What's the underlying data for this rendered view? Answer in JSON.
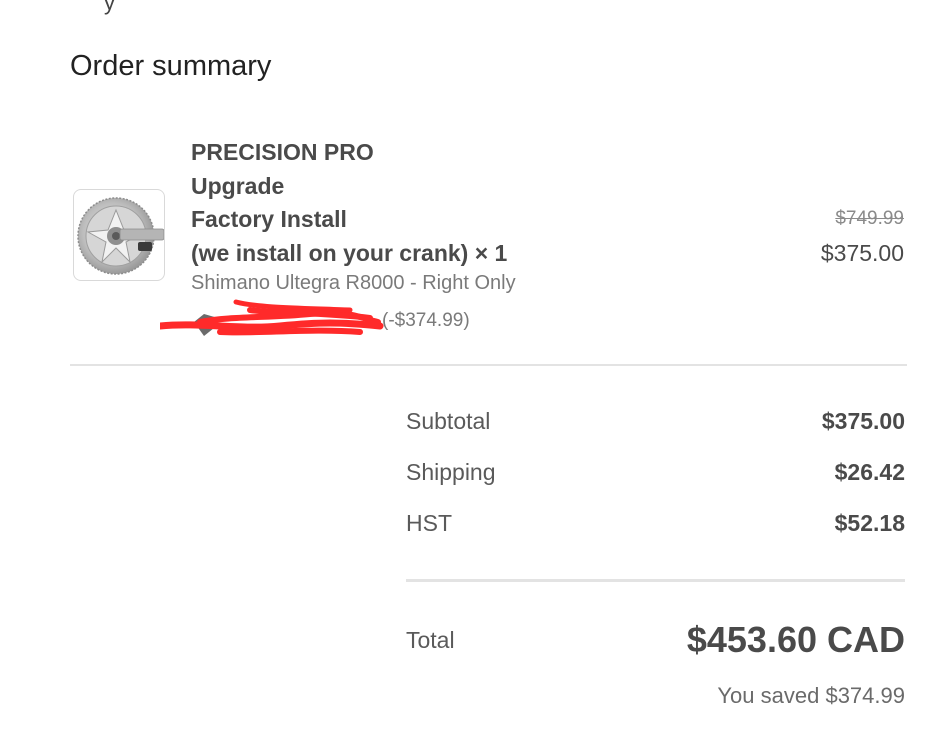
{
  "top_fragment": "y",
  "order_summary": {
    "title": "Order summary",
    "item": {
      "name_lines": [
        "PRECISION PRO",
        "Upgrade",
        "Factory Install",
        "(we install on your crank) × 1"
      ],
      "variant": "Shimano Ultegra R8000 - Right Only",
      "discount_amount": "(-$374.99)",
      "original_price": "$749.99",
      "price": "$375.00",
      "image_icon": "chainring-crankset-icon"
    },
    "totals": {
      "subtotal_label": "Subtotal",
      "subtotal_value": "$375.00",
      "shipping_label": "Shipping",
      "shipping_value": "$26.42",
      "tax_label": "HST",
      "tax_value": "$52.18",
      "total_label": "Total",
      "total_value": "$453.60 CAD",
      "saved_text": "You saved $374.99"
    }
  },
  "colors": {
    "redaction": "#ff2a2a",
    "divider": "#e3e3e3"
  }
}
